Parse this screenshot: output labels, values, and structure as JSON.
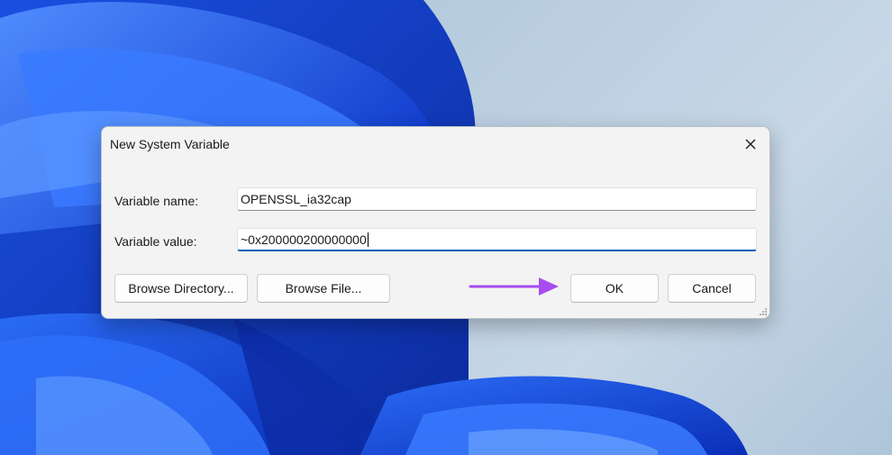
{
  "dialog": {
    "title": "New System Variable",
    "variable_name_label": "Variable name:",
    "variable_name_value": "OPENSSL_ia32cap",
    "variable_value_label": "Variable value:",
    "variable_value_value": "~0x200000200000000",
    "buttons": {
      "browse_directory": "Browse Directory...",
      "browse_file": "Browse File...",
      "ok": "OK",
      "cancel": "Cancel"
    },
    "close_icon": "close-icon"
  },
  "annotation": {
    "arrow_color": "#a64cf0"
  },
  "colors": {
    "accent": "#005fb8",
    "wallpaper_bloom": "#1f5cf0"
  }
}
